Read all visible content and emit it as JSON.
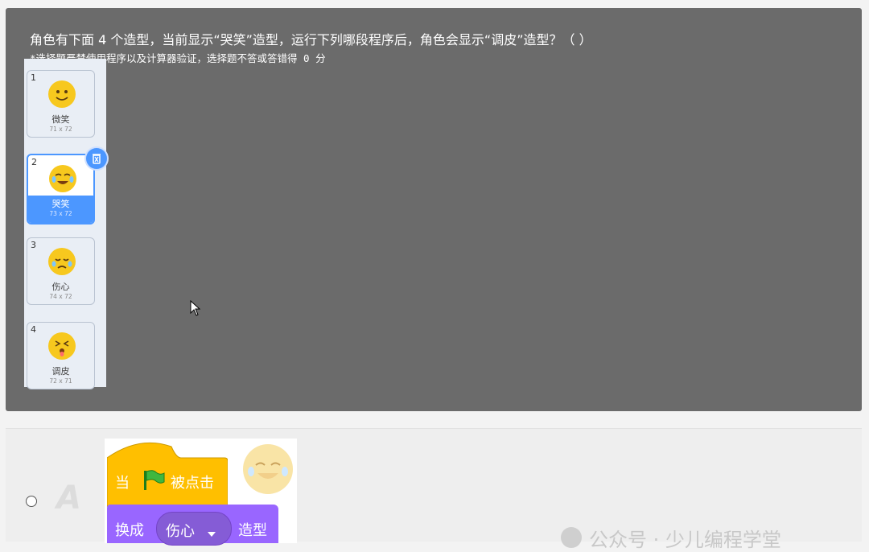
{
  "question": {
    "title": "角色有下面 4 个造型，当前显示“哭笑”造型，运行下列哪段程序后，角色会显示“调皮”造型？（ ）",
    "note": "*选择题严禁使用程序以及计算器验证，选择题不答或答错得 0 分"
  },
  "costumes": [
    {
      "num": "1",
      "name": "微笑",
      "size": "71 x 72",
      "emotion": "smile"
    },
    {
      "num": "2",
      "name": "哭笑",
      "size": "73 x 72",
      "emotion": "laugh-cry",
      "selected": true
    },
    {
      "num": "3",
      "name": "伤心",
      "size": "74 x 72",
      "emotion": "sad"
    },
    {
      "num": "4",
      "name": "调皮",
      "size": "72 x 71",
      "emotion": "playful"
    }
  ],
  "icons": {
    "delete": "trash-icon",
    "cursor": "mouse-pointer-icon",
    "flag": "green-flag-icon"
  },
  "answer_option": {
    "letter": "A",
    "hat_block": {
      "prefix": "当",
      "suffix": "被点击"
    },
    "looks_block": {
      "prefix": "换成",
      "costume": "伤心",
      "suffix": "造型"
    }
  },
  "watermark": "公众号 · 少儿编程学堂",
  "colors": {
    "panel": "#6b6b6b",
    "accent": "#4c97ff",
    "events_block": "#ffbf00",
    "looks_block": "#9966ff",
    "emoji": "#f7c81e"
  }
}
